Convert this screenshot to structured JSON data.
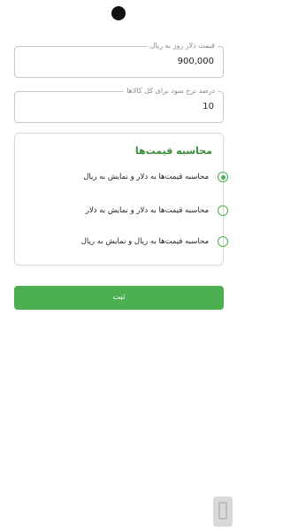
{
  "status_bar": {
    "left_icons": "▪ ▪ ▪",
    "right_icons": "▪ ▪ ▪"
  },
  "form": {
    "dollar_rate": {
      "label": "قیمت دلار روز به ریال",
      "value": "900,000"
    },
    "profit_percent": {
      "label": "درصد نرخ سود برای کل کالاها",
      "value": "10"
    }
  },
  "price_calc": {
    "title": "محاسبه قیمت‌ها",
    "options": [
      {
        "label": "محاسبه قیمت‌ها به دلار و نمایش به ریال",
        "selected": true
      },
      {
        "label": "محاسبه قیمت‌ها به دلار و نمایش به دلار",
        "selected": false
      },
      {
        "label": "محاسبه قیمت‌ها به ریال و نمایش به ریال",
        "selected": false
      }
    ]
  },
  "submit_label": "ثبت",
  "colors": {
    "accent": "#4caf50",
    "title_green": "#3c8b3a"
  },
  "icons": {
    "camera": "camera-cutout-icon",
    "radio": "radio-icon",
    "watermark": "app-logo-watermark"
  }
}
